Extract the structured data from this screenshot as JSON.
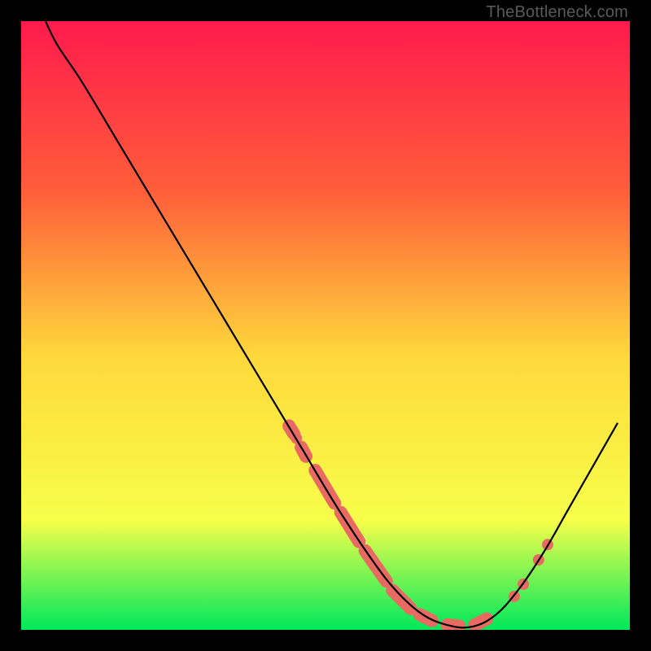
{
  "watermark": "TheBottleneck.com",
  "colors": {
    "gradient_top": "#ff1a4d",
    "gradient_mid_upper": "#ff5e3a",
    "gradient_mid": "#ffd83b",
    "gradient_lower": "#f6ff4a",
    "gradient_bottom": "#00e85c",
    "curve": "#000000",
    "marker": "#e86a63"
  },
  "chart_data": {
    "type": "line",
    "title": "",
    "xlabel": "",
    "ylabel": "",
    "xlim": [
      0,
      100
    ],
    "ylim": [
      0,
      100
    ],
    "grid": false,
    "legend": false,
    "curve_points": [
      {
        "x": 4.0,
        "y": 100.0
      },
      {
        "x": 6.0,
        "y": 96.0
      },
      {
        "x": 10.0,
        "y": 90.0
      },
      {
        "x": 16.0,
        "y": 80.0
      },
      {
        "x": 22.0,
        "y": 70.0
      },
      {
        "x": 28.0,
        "y": 60.0
      },
      {
        "x": 34.0,
        "y": 50.0
      },
      {
        "x": 40.0,
        "y": 40.0
      },
      {
        "x": 46.0,
        "y": 30.0
      },
      {
        "x": 52.0,
        "y": 20.0
      },
      {
        "x": 58.0,
        "y": 11.0
      },
      {
        "x": 62.0,
        "y": 6.0
      },
      {
        "x": 66.0,
        "y": 2.5
      },
      {
        "x": 70.0,
        "y": 0.8
      },
      {
        "x": 74.0,
        "y": 0.5
      },
      {
        "x": 78.0,
        "y": 2.5
      },
      {
        "x": 82.0,
        "y": 7.0
      },
      {
        "x": 86.0,
        "y": 13.0
      },
      {
        "x": 90.0,
        "y": 20.0
      },
      {
        "x": 94.0,
        "y": 27.0
      },
      {
        "x": 98.0,
        "y": 34.0
      }
    ],
    "marker_segments": [
      {
        "x1": 44.0,
        "y1": 33.5,
        "x2": 44.8,
        "y2": 32.2
      },
      {
        "x1": 46.0,
        "y1": 30.0,
        "x2": 46.8,
        "y2": 28.5
      },
      {
        "x1": 48.3,
        "y1": 26.2,
        "x2": 51.5,
        "y2": 20.8
      },
      {
        "x1": 52.5,
        "y1": 19.3,
        "x2": 55.5,
        "y2": 14.5
      },
      {
        "x1": 56.5,
        "y1": 13.0,
        "x2": 60.0,
        "y2": 8.0
      },
      {
        "x1": 61.0,
        "y1": 6.5,
        "x2": 64.0,
        "y2": 3.5
      },
      {
        "x1": 65.5,
        "y1": 2.5,
        "x2": 67.5,
        "y2": 1.5
      },
      {
        "x1": 70.0,
        "y1": 0.8,
        "x2": 72.0,
        "y2": 0.6
      },
      {
        "x1": 74.5,
        "y1": 0.8,
        "x2": 76.5,
        "y2": 1.8
      }
    ],
    "marker_dots": [
      {
        "x": 44.0,
        "y": 33.5
      },
      {
        "x": 45.2,
        "y": 31.5
      },
      {
        "x": 81.0,
        "y": 5.5
      },
      {
        "x": 82.5,
        "y": 7.5
      },
      {
        "x": 85.0,
        "y": 11.5
      },
      {
        "x": 86.5,
        "y": 14.0
      }
    ]
  }
}
